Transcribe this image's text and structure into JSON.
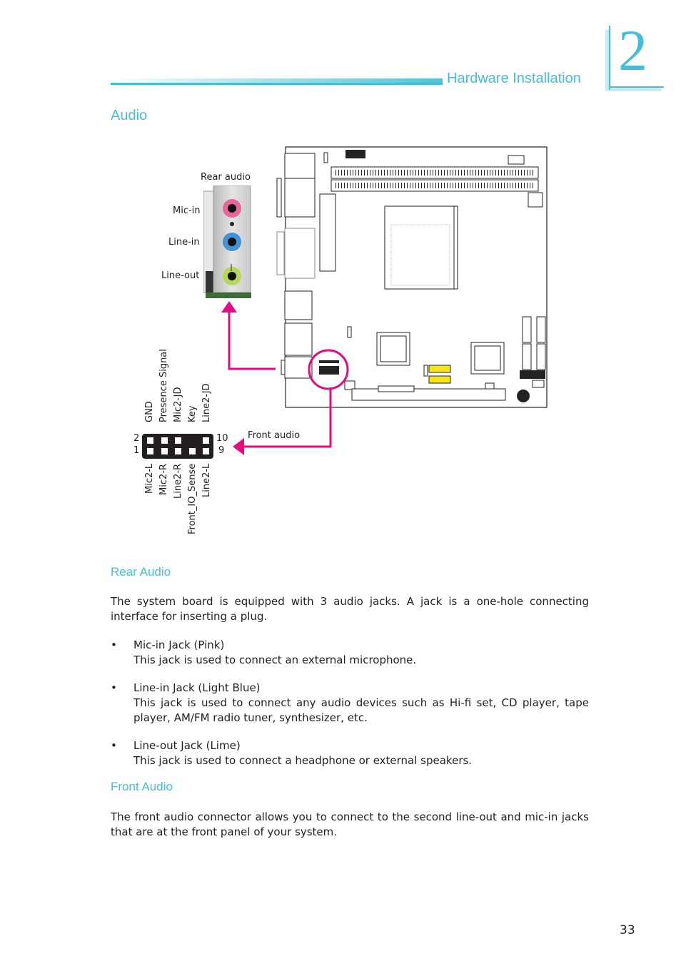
{
  "header": {
    "section_title": "Hardware Installation",
    "chapter_number": "2",
    "accent_color": "#46bfd6"
  },
  "page_title": "Audio",
  "figure": {
    "rear_audio_label": "Rear audio",
    "jacks": [
      {
        "label": "Mic-in",
        "color": "#e9669b"
      },
      {
        "label": "Line-in",
        "color": "#3f94d8"
      },
      {
        "label": "Line-out",
        "color": "#b5d85a"
      }
    ],
    "front_audio_label": "Front audio",
    "arrow_color": "#e6097f",
    "header_pins": {
      "top_row_labels": [
        "GND",
        "Presence Signal",
        "Mic2-JD",
        "Key",
        "Line2-JD"
      ],
      "bottom_row_labels": [
        "Mic2-L",
        "Mic2-R",
        "Line2-R",
        "Front_IO_Sense",
        "Line2-L"
      ],
      "pin_2": "2",
      "pin_1": "1",
      "pin_10": "10",
      "pin_9": "9"
    }
  },
  "rear_audio": {
    "heading": "Rear Audio",
    "intro": "The system board is equipped with 3 audio jacks. A jack is a one-hole connecting interface for inserting a plug.",
    "bullets": [
      {
        "title": "Mic-in Jack (Pink)",
        "desc": "This jack is used to connect an external microphone."
      },
      {
        "title": "Line-in Jack (Light Blue)",
        "desc": "This jack is used to connect any audio devices such as Hi-fi set, CD player, tape player, AM/FM radio tuner, synthesizer, etc."
      },
      {
        "title": "Line-out Jack (Lime)",
        "desc": "This jack is used to connect a headphone or external speakers."
      }
    ]
  },
  "front_audio": {
    "heading": "Front Audio",
    "body": "The front audio connector allows you to connect to the second line-out and mic-in jacks that are at the front panel of your system."
  },
  "page_number": "33"
}
